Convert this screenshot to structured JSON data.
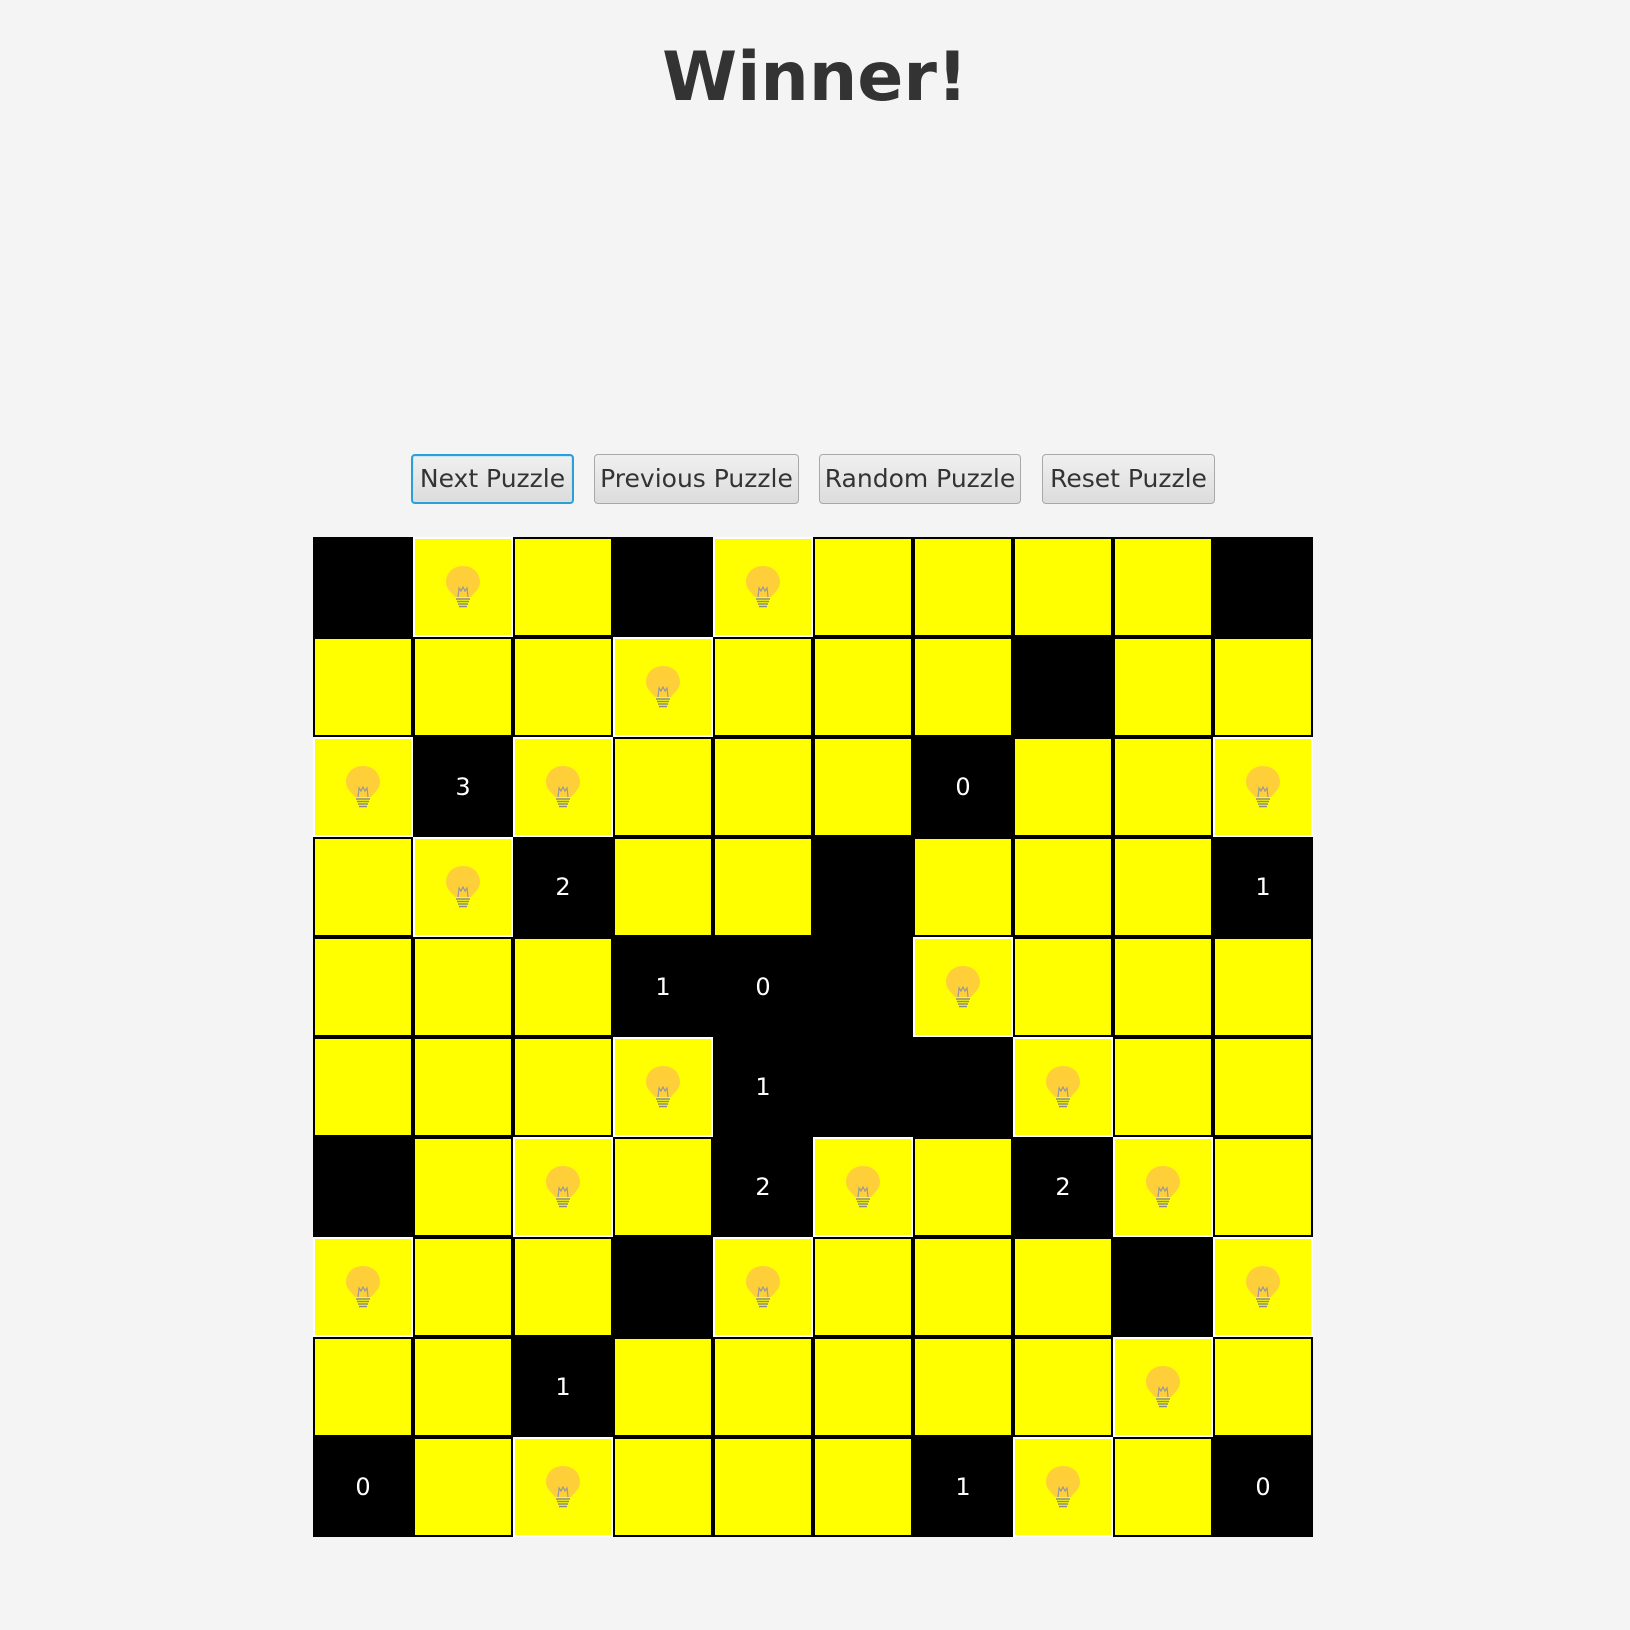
{
  "header": {
    "title": "Winner!"
  },
  "toolbar": {
    "buttons": [
      {
        "label": "Next Puzzle",
        "focused": true
      },
      {
        "label": "Previous Puzzle",
        "focused": false
      },
      {
        "label": "Random Puzzle",
        "focused": false
      },
      {
        "label": "Reset Puzzle",
        "focused": false
      }
    ]
  },
  "colors": {
    "lit": "#ffff00",
    "wall": "#000000",
    "bulb": "#ffcf3a",
    "clue_text": "#ffffff"
  },
  "board": {
    "rows": 10,
    "cols": 10,
    "legend": {
      "W": "wall",
      "L": "lit",
      "B": "bulb",
      "0": "clue-0",
      "1": "clue-1",
      "2": "clue-2",
      "3": "clue-3"
    },
    "grid": [
      [
        "W",
        "B",
        "L",
        "W",
        "B",
        "L",
        "L",
        "L",
        "L",
        "W"
      ],
      [
        "L",
        "L",
        "L",
        "B",
        "L",
        "L",
        "L",
        "W",
        "L",
        "L"
      ],
      [
        "B",
        "3",
        "B",
        "L",
        "L",
        "L",
        "0",
        "L",
        "L",
        "B"
      ],
      [
        "L",
        "B",
        "2",
        "L",
        "L",
        "W",
        "L",
        "L",
        "L",
        "1"
      ],
      [
        "L",
        "L",
        "L",
        "1",
        "0",
        "W",
        "B",
        "L",
        "L",
        "L"
      ],
      [
        "L",
        "L",
        "L",
        "B",
        "1",
        "W",
        "W",
        "B",
        "L",
        "L"
      ],
      [
        "W",
        "L",
        "B",
        "L",
        "2",
        "B",
        "L",
        "2",
        "B",
        "L"
      ],
      [
        "B",
        "L",
        "L",
        "W",
        "B",
        "L",
        "L",
        "L",
        "W",
        "B"
      ],
      [
        "L",
        "L",
        "1",
        "L",
        "L",
        "L",
        "L",
        "L",
        "B",
        "L"
      ],
      [
        "0",
        "L",
        "B",
        "L",
        "L",
        "L",
        "1",
        "B",
        "L",
        "0"
      ]
    ]
  }
}
